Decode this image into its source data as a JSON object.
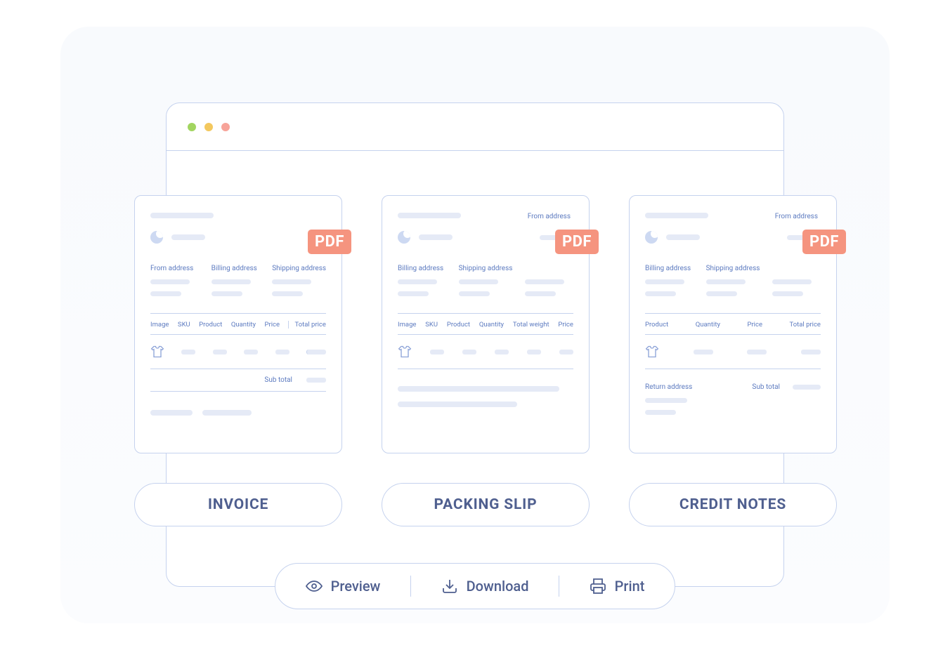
{
  "badge": {
    "pdf": "PDF"
  },
  "invoice": {
    "addresses": {
      "from": "From address",
      "billing": "Billing address",
      "shipping": "Shipping address"
    },
    "columns": {
      "image": "Image",
      "sku": "SKU",
      "product": "Product",
      "quantity": "Quantity",
      "price": "Price",
      "total_price": "Total price"
    },
    "subtotal": "Sub total",
    "pill": "INVOICE"
  },
  "packing": {
    "from_top": "From address",
    "addresses": {
      "billing": "Billing address",
      "shipping": "Shipping address"
    },
    "columns": {
      "image": "Image",
      "sku": "SKU",
      "product": "Product",
      "quantity": "Quantity",
      "total_weight": "Total weight",
      "price": "Price"
    },
    "pill": "PACKING SLIP"
  },
  "credit": {
    "from_top": "From address",
    "addresses": {
      "billing": "Billing address",
      "shipping": "Shipping address"
    },
    "columns": {
      "product": "Product",
      "quantity": "Quantity",
      "price": "Price",
      "total_price": "Total price"
    },
    "return_address": "Return address",
    "subtotal": "Sub total",
    "pill": "CREDIT NOTES"
  },
  "actions": {
    "preview": "Preview",
    "download": "Download",
    "print": "Print"
  }
}
